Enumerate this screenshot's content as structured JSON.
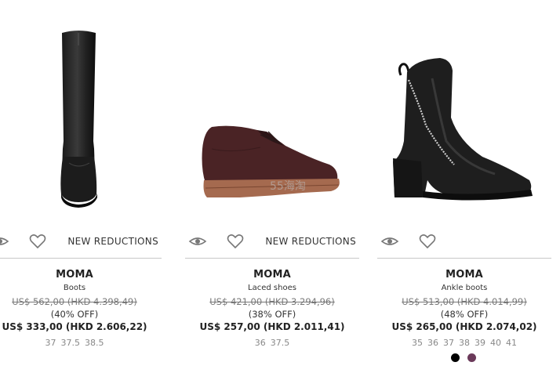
{
  "products": [
    {
      "label": "NEW REDUCTIONS",
      "brand": "MOMA",
      "category": "Boots",
      "original_price": "US$ 562,00 (HKD 4.398,49)",
      "discount": "(40% OFF)",
      "price": "US$ 333,00 (HKD 2.606,22)",
      "sizes": [
        "37",
        "37.5",
        "38.5"
      ],
      "image_icon": "tall-black-boot"
    },
    {
      "label": "NEW REDUCTIONS",
      "brand": "MOMA",
      "category": "Laced shoes",
      "original_price": "US$ 421,00 (HKD 3.294,96)",
      "discount": "(38% OFF)",
      "price": "US$ 257,00 (HKD 2.011,41)",
      "sizes": [
        "36",
        "37.5"
      ],
      "image_icon": "brown-lace-up-shoe"
    },
    {
      "brand": "MOMA",
      "category": "Ankle boots",
      "original_price": "US$ 513,00 (HKD 4.014,99)",
      "discount": "(48% OFF)",
      "price": "US$ 265,00 (HKD 2.074,02)",
      "sizes": [
        "35",
        "36",
        "37",
        "38",
        "39",
        "40",
        "41"
      ],
      "image_icon": "black-zip-ankle-boot",
      "colors": [
        "#000000",
        "#6b3a5a"
      ]
    }
  ],
  "watermark": "55海淘",
  "icons": {
    "view": "eye-icon",
    "wishlist": "heart-icon"
  }
}
